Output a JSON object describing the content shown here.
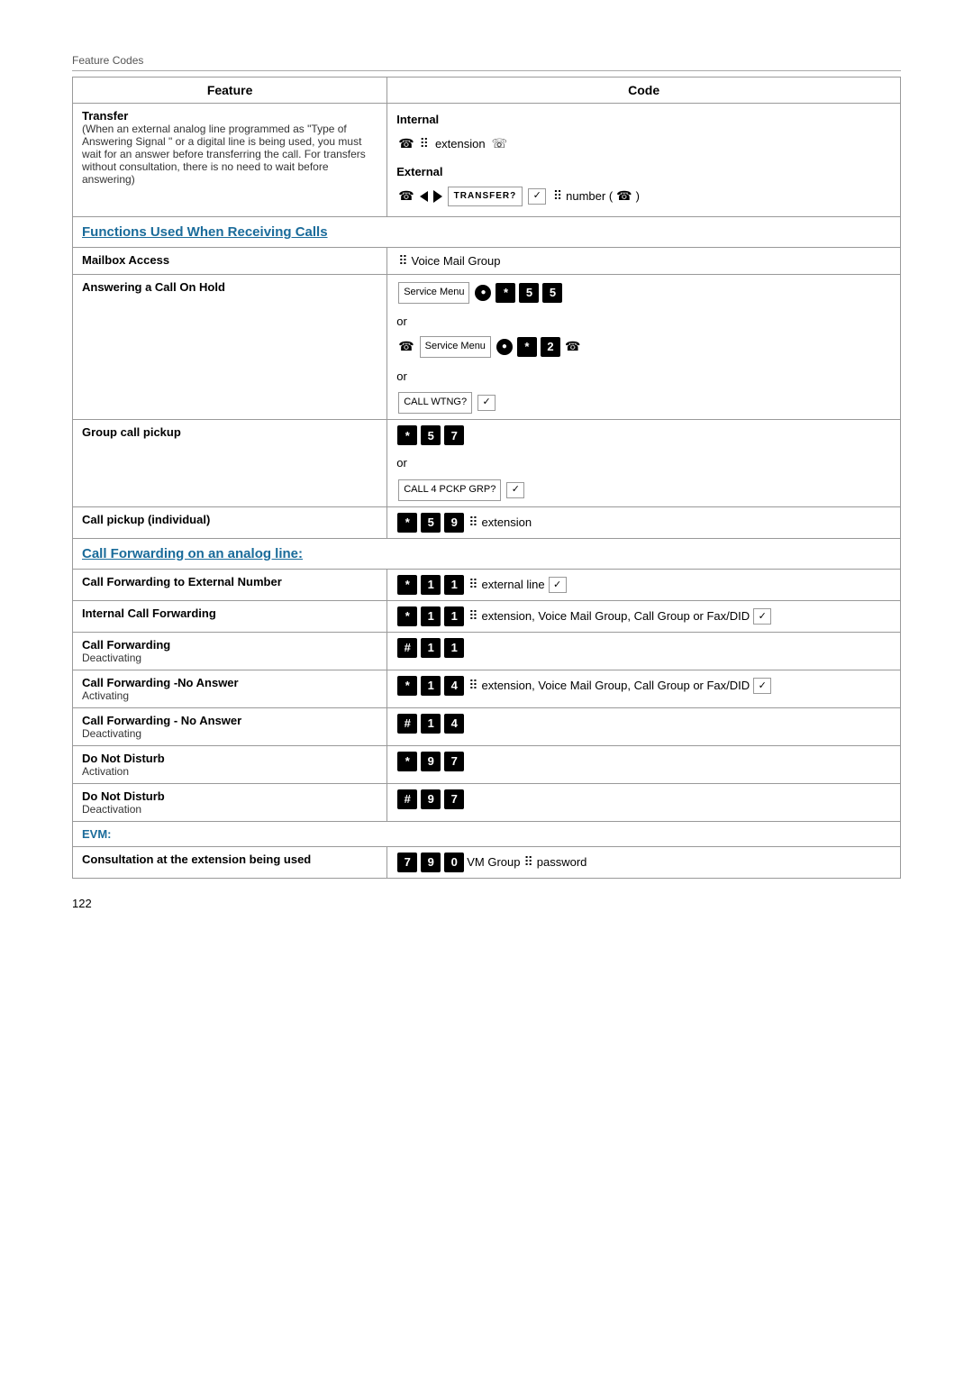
{
  "header": {
    "label": "Feature Codes"
  },
  "table": {
    "col1_header": "Feature",
    "col2_header": "Code",
    "rows": [
      {
        "feature": "Transfer",
        "feature_detail": "(When an external analog line programmed as \"Type of Answering Signal \" or a digital line is being used, you must wait for an answer before transferring the call. For transfers without consultation, there is no need to wait before answering)",
        "code_type": "transfer"
      },
      {
        "section_header": "Functions Used When Receiving Calls",
        "span": 2
      },
      {
        "feature": "Mailbox Access",
        "code_type": "mailbox"
      },
      {
        "feature": "Answering a Call On Hold",
        "code_type": "answering_hold"
      },
      {
        "feature": "Group call pickup",
        "code_type": "group_call_pickup"
      },
      {
        "feature": "Call pickup (individual)",
        "code_type": "call_pickup_individual"
      },
      {
        "section_header": "Call Forwarding on an analog line:",
        "span": 2,
        "color": "blue"
      },
      {
        "feature": "Call Forwarding to External Number",
        "code_type": "cf_external"
      },
      {
        "feature": "Internal Call Forwarding",
        "code_type": "cf_internal"
      },
      {
        "feature": "Call Forwarding",
        "feature_sub": "Deactivating",
        "code_type": "cf_deactivate"
      },
      {
        "feature": "Call Forwarding -No Answer",
        "feature_sub": "Activating",
        "code_type": "cf_no_answer_activate"
      },
      {
        "feature": "Call Forwarding - No Answer",
        "feature_sub": "Deactivating",
        "code_type": "cf_no_answer_deactivate"
      },
      {
        "feature": "Do Not Disturb",
        "feature_sub": "Activation",
        "code_type": "dnd_activate"
      },
      {
        "feature": "Do Not Disturb",
        "feature_sub": "Deactivation",
        "code_type": "dnd_deactivate"
      },
      {
        "section_header": "EVM:",
        "span": 2,
        "color": "blue"
      },
      {
        "feature": "Consultation at the extension being used",
        "feature_bold": true,
        "code_type": "evm_consultation"
      }
    ]
  },
  "page_number": "122"
}
